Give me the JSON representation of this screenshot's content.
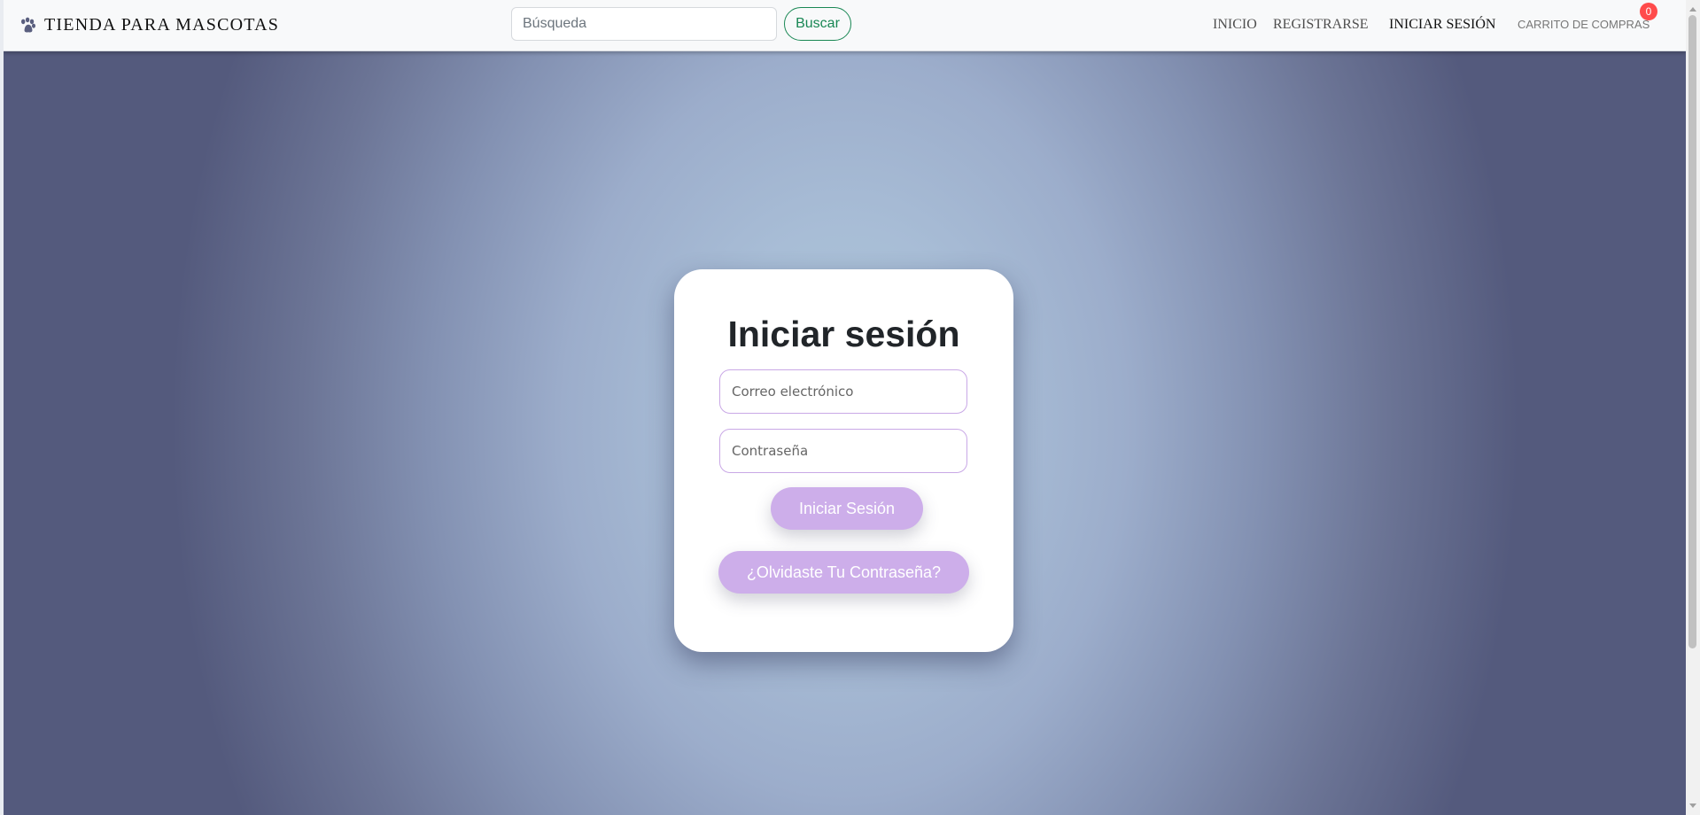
{
  "header": {
    "brand": {
      "icon": "paw-icon",
      "text": "TIENDA PARA MASCOTAS"
    },
    "search": {
      "placeholder": "Búsqueda",
      "value": "",
      "button_label": "Buscar"
    },
    "nav": {
      "items": [
        {
          "label": "INICIO"
        },
        {
          "label": "REGISTRARSE"
        },
        {
          "label": "INICIAR SESIÓN",
          "active": true
        },
        {
          "label": "CARRITO DE COMPRAS"
        }
      ],
      "cart_count": "0"
    }
  },
  "login": {
    "title": "Iniciar sesión",
    "email": {
      "placeholder": "Correo electrónico",
      "value": ""
    },
    "password": {
      "placeholder": "Contraseña",
      "value": ""
    },
    "submit_label": "Iniciar Sesión",
    "forgot_label": "¿Olvidaste Tu Contraseña?"
  },
  "colors": {
    "brand_green": "#198754",
    "button_lavender": "#cdaeea",
    "badge_red": "#ff4b4b",
    "background_center": "#aec7da",
    "background_edge": "#545a7d"
  }
}
